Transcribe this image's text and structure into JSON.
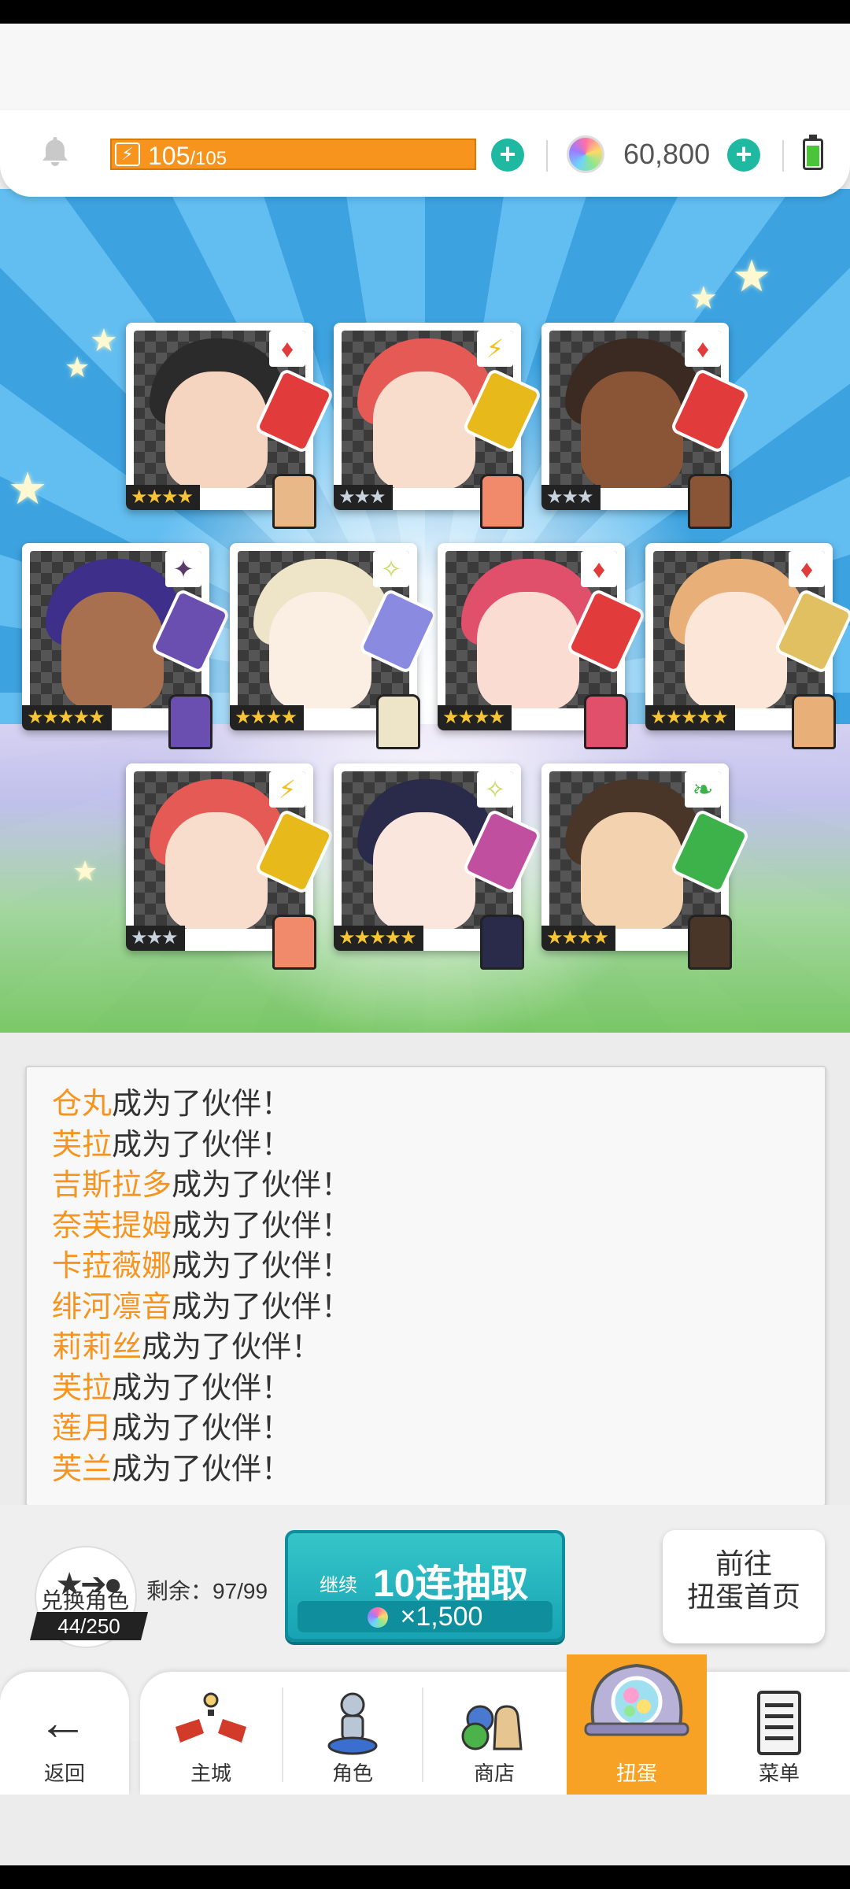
{
  "header": {
    "stamina_current": "105",
    "stamina_max": "/105",
    "gems": "60,800"
  },
  "cards": [
    {
      "element": "diamond",
      "element_glyph": "♦",
      "element_color": "#e23b3b",
      "rarity": "★★★★",
      "rarity_color": "gold",
      "hair": "#2b2b2b",
      "skin": "#f6d5c0",
      "weapon": "#e23b3b",
      "sprite": "#e8b888"
    },
    {
      "element": "lightning",
      "element_glyph": "⚡",
      "element_color": "#f2c018",
      "rarity": "★★★",
      "rarity_color": "silver",
      "hair": "#e65a55",
      "skin": "#f8dccc",
      "weapon": "#e8b91a",
      "sprite": "#f08a6a"
    },
    {
      "element": "diamond",
      "element_glyph": "♦",
      "element_color": "#e23b3b",
      "rarity": "★★★",
      "rarity_color": "silver",
      "hair": "#3a2a22",
      "skin": "#8a5537",
      "weapon": "#e23b3b",
      "sprite": "#8a5537"
    },
    {
      "element": "dark",
      "element_glyph": "✦",
      "element_color": "#5a3a6a",
      "rarity": "★★★★★",
      "rarity_color": "gold",
      "hair": "#3e2f8a",
      "skin": "#a8704f",
      "weapon": "#6a4fb0",
      "sprite": "#6a4fb0"
    },
    {
      "element": "light",
      "element_glyph": "✧",
      "element_color": "#c8d860",
      "rarity": "★★★★",
      "rarity_color": "gold",
      "hair": "#eee4c8",
      "skin": "#fbeee2",
      "weapon": "#8a8ae0",
      "sprite": "#eee4c8"
    },
    {
      "element": "diamond",
      "element_glyph": "♦",
      "element_color": "#e23b3b",
      "rarity": "★★★★",
      "rarity_color": "gold",
      "hair": "#e0506a",
      "skin": "#fadcd2",
      "weapon": "#e23b3b",
      "sprite": "#e0506a"
    },
    {
      "element": "diamond",
      "element_glyph": "♦",
      "element_color": "#e23b3b",
      "rarity": "★★★★★",
      "rarity_color": "gold",
      "hair": "#e8b078",
      "skin": "#fbe6d8",
      "weapon": "#e0c060",
      "sprite": "#e8b078"
    },
    {
      "element": "lightning",
      "element_glyph": "⚡",
      "element_color": "#f2c018",
      "rarity": "★★★",
      "rarity_color": "silver",
      "hair": "#e65a55",
      "skin": "#f8dccc",
      "weapon": "#e8b91a",
      "sprite": "#f08a6a"
    },
    {
      "element": "light",
      "element_glyph": "✧",
      "element_color": "#c8d860",
      "rarity": "★★★★★",
      "rarity_color": "gold",
      "hair": "#2a2a4a",
      "skin": "#fae6dc",
      "weapon": "#c04fa0",
      "sprite": "#2a2a4a"
    },
    {
      "element": "wind",
      "element_glyph": "❧",
      "element_color": "#3db24a",
      "rarity": "★★★★",
      "rarity_color": "gold",
      "hair": "#4a3628",
      "skin": "#f3d2b0",
      "weapon": "#3db24a",
      "sprite": "#4a3628"
    }
  ],
  "log": [
    {
      "name": "仓丸",
      "msg": "成为了伙伴！"
    },
    {
      "name": "芙拉",
      "msg": "成为了伙伴！"
    },
    {
      "name": "吉斯拉多",
      "msg": "成为了伙伴！"
    },
    {
      "name": "奈芙提姆",
      "msg": "成为了伙伴！"
    },
    {
      "name": "卡菈薇娜",
      "msg": "成为了伙伴！"
    },
    {
      "name": "绯河凛音",
      "msg": "成为了伙伴！"
    },
    {
      "name": "莉莉丝",
      "msg": "成为了伙伴！"
    },
    {
      "name": "芙拉",
      "msg": "成为了伙伴！"
    },
    {
      "name": "莲月",
      "msg": "成为了伙伴！"
    },
    {
      "name": "芙兰",
      "msg": "成为了伙伴！"
    }
  ],
  "actions": {
    "swap_label": "兑换角色",
    "swap_count": "44/250",
    "remaining": "剩余：97/99",
    "draw_prefix": "继续",
    "draw_label": "10连抽取",
    "draw_cost": "×1,500",
    "goto_line1": "前往",
    "goto_line2": "扭蛋首页"
  },
  "nav": {
    "back": "返回",
    "tabs": [
      {
        "label": "主城",
        "icon": "castle-icon"
      },
      {
        "label": "角色",
        "icon": "character-icon"
      },
      {
        "label": "商店",
        "icon": "shop-icon"
      },
      {
        "label": "扭蛋",
        "icon": "gacha-icon",
        "active": true
      },
      {
        "label": "菜单",
        "icon": "menu-icon"
      }
    ]
  },
  "colors": {
    "accent_orange": "#f7941d",
    "teal": "#1fb8a0",
    "active_tab": "#f7a224"
  }
}
